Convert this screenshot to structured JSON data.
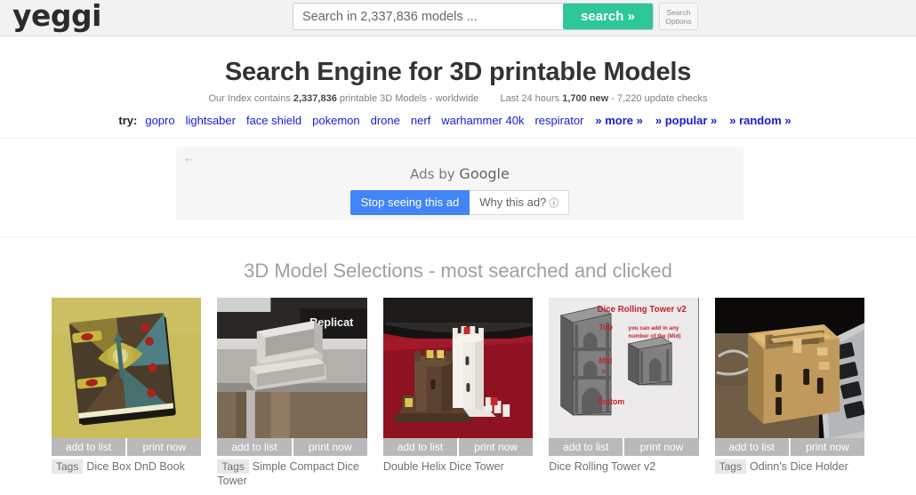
{
  "header": {
    "logo": "yeggi",
    "search": {
      "placeholder": "Search in 2,337,836 models ...",
      "value": "",
      "button_label": "search »",
      "options_line1": "Search",
      "options_line2": "Options"
    }
  },
  "hero": {
    "title": "Search Engine for 3D printable Models",
    "index_prefix": "Our Index contains ",
    "index_count": "2,337,836",
    "index_suffix": " printable 3D Models - worldwide",
    "last24_prefix": "Last 24 hours ",
    "last24_new": "1,700 new",
    "last24_suffix": " - 7,220 update checks",
    "try_label": "try:",
    "try_links": [
      {
        "label": "gopro",
        "strong": false
      },
      {
        "label": "lightsaber",
        "strong": false
      },
      {
        "label": "face shield",
        "strong": false
      },
      {
        "label": "pokemon",
        "strong": false
      },
      {
        "label": "drone",
        "strong": false
      },
      {
        "label": "nerf",
        "strong": false
      },
      {
        "label": "warhammer 40k",
        "strong": false
      },
      {
        "label": "respirator",
        "strong": false
      },
      {
        "label": "» more »",
        "strong": true
      },
      {
        "label": "» popular »",
        "strong": true
      },
      {
        "label": "» random »",
        "strong": true
      }
    ]
  },
  "ad": {
    "back_icon": "←",
    "ads_by_prefix": "Ads by ",
    "ads_by_brand": "Google",
    "stop_label": "Stop seeing this ad",
    "why_label": "Why this ad?",
    "why_info_icon": "ⓘ",
    "accent_blue": "#4285f4"
  },
  "selections": {
    "title": "3D Model Selections - most searched and clicked",
    "add_label": "add to list",
    "print_label": "print now",
    "tags_label": "Tags",
    "cards": [
      {
        "title": "Dice Box DnD Book",
        "has_tags": true,
        "image": "dice-box-dnd-book-thumbnail"
      },
      {
        "title": "Simple Compact Dice Tower",
        "has_tags": true,
        "image": "simple-compact-dice-tower-thumbnail"
      },
      {
        "title": "Double Helix Dice Tower",
        "has_tags": false,
        "image": "double-helix-dice-tower-thumbnail"
      },
      {
        "title": "Dice Rolling Tower v2",
        "has_tags": false,
        "image": "dice-rolling-tower-v2-thumbnail"
      },
      {
        "title": "Odinn's Dice Holder",
        "has_tags": true,
        "image": "odinns-dice-holder-thumbnail"
      }
    ],
    "card4_annotations": {
      "title": "Dice Rolling Tower v2",
      "top": "Top",
      "mid": "Mid",
      "equals": "=",
      "bottom": "Bottom",
      "note_line1": "you can add in any",
      "note_line2": "number of the (Mid)",
      "color": "#c0232e"
    }
  }
}
